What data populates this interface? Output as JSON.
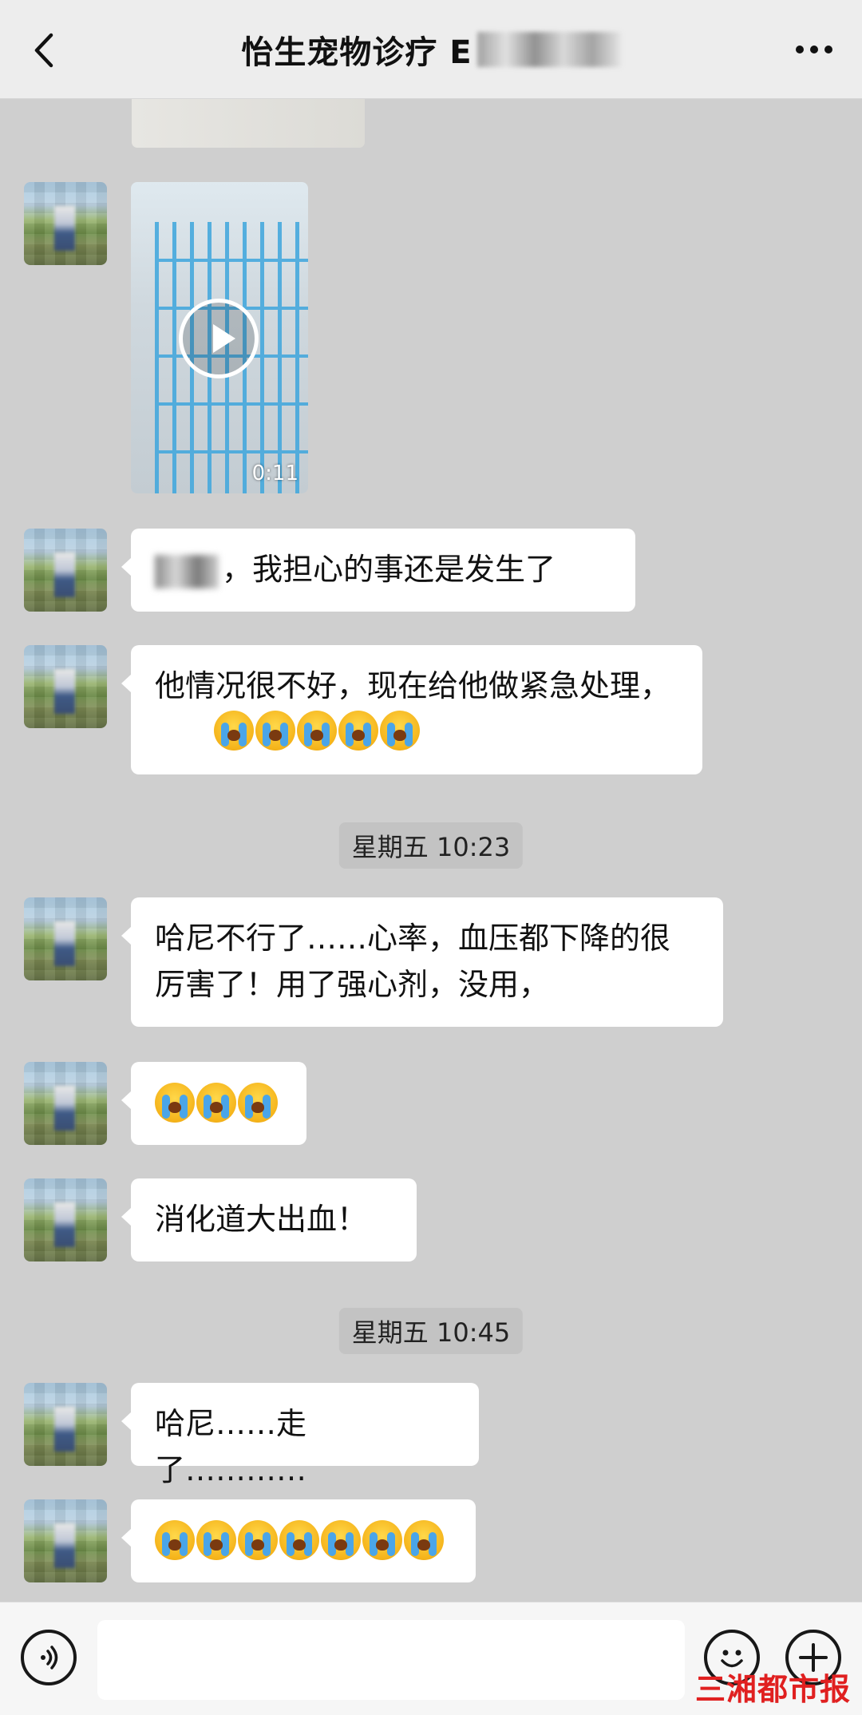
{
  "header": {
    "title": "怡生宠物诊疗 E",
    "back_icon": "chevron-left-icon",
    "more_icon": "more-dots-icon"
  },
  "messages": {
    "video_duration": "0:11",
    "m1_text": "，我担心的事还是发生了",
    "m2_text": "他情况很不好，现在给他做紧急处理，",
    "time1": "星期五 10:23",
    "m3_text": "哈尼不行了……心率，血压都下降的很厉害了！用了强心剂，没用，",
    "m5_text": "消化道大出血！",
    "time2": "星期五 10:45",
    "m6_text": "哈尼……走了…………",
    "cry_emoji": "loudly-crying-face"
  },
  "input_bar": {
    "text_value": "",
    "voice_icon": "voice-icon",
    "emoji_icon": "emoji-icon",
    "plus_icon": "plus-icon"
  },
  "watermark": "三湘都市报"
}
